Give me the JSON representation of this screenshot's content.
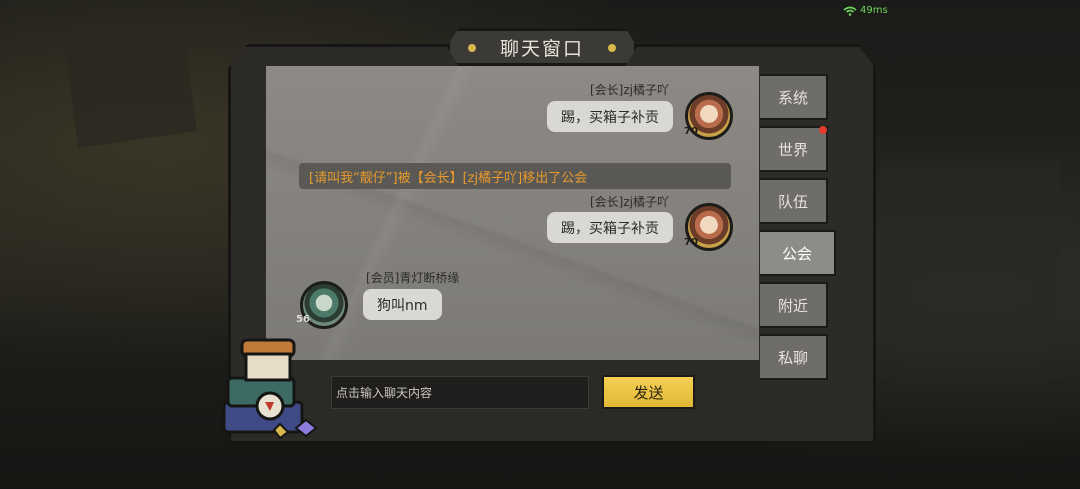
{
  "status": {
    "ping": "49ms"
  },
  "window": {
    "title": "聊天窗口"
  },
  "messages": [
    {
      "name": "[会长]zj橘子吖",
      "text": "踢，买箱子补贡",
      "level": "70"
    },
    {
      "notice": "[请叫我“靓仔”]被【会长】[zj橘子吖]移出了公会"
    },
    {
      "name": "[会长]zj橘子吖",
      "text": "踢，买箱子补贡",
      "level": "70"
    },
    {
      "name": "[会员]青灯断桥缘",
      "text": "狗叫nm",
      "level": "56"
    }
  ],
  "input": {
    "placeholder": "点击输入聊天内容",
    "send_label": "发送"
  },
  "tabs": [
    {
      "label": "系统",
      "active": false
    },
    {
      "label": "世界",
      "active": false,
      "unread": true
    },
    {
      "label": "队伍",
      "active": false
    },
    {
      "label": "公会",
      "active": true
    },
    {
      "label": "附近",
      "active": false
    },
    {
      "label": "私聊",
      "active": false
    }
  ],
  "colors": {
    "accent": "#e2b835",
    "notice_text": "#e89a2c",
    "ping": "#6fd45b",
    "unread": "#e23b2e"
  }
}
